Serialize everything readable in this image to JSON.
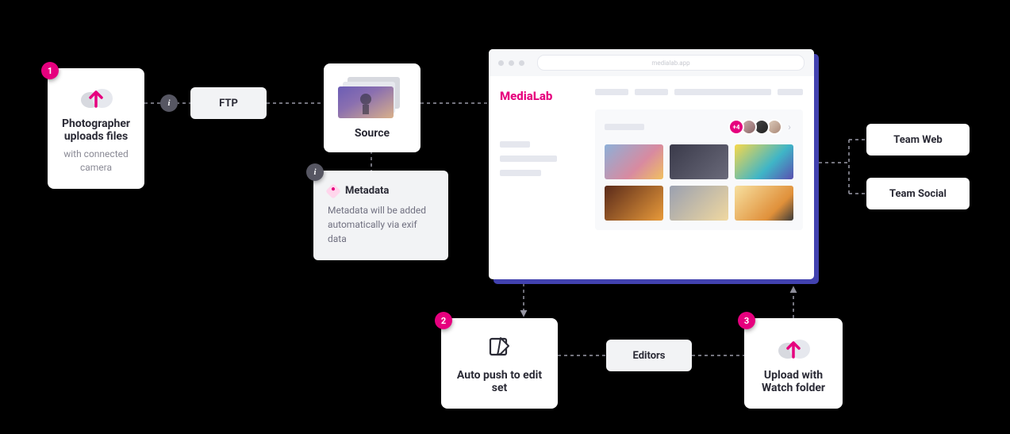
{
  "steps": {
    "one": "1",
    "two": "2",
    "three": "3"
  },
  "info_badge": "i",
  "box_photographer": {
    "title": "Photographer uploads files",
    "sub": "with connected camera"
  },
  "box_ftp": {
    "label": "FTP"
  },
  "box_source": {
    "title": "Source"
  },
  "box_metadata": {
    "title": "Metadata",
    "body": "Metadata will be added automatically via exif data"
  },
  "app": {
    "url_text": "medialab.app",
    "brand": "MediaLab",
    "avatar_overflow": "+4"
  },
  "box_autopush": {
    "title": "Auto push to edit set"
  },
  "box_editors": {
    "label": "Editors"
  },
  "box_upload": {
    "title": "Upload with Watch folder"
  },
  "box_team_web": {
    "label": "Team Web"
  },
  "box_team_social": {
    "label": "Team Social"
  }
}
